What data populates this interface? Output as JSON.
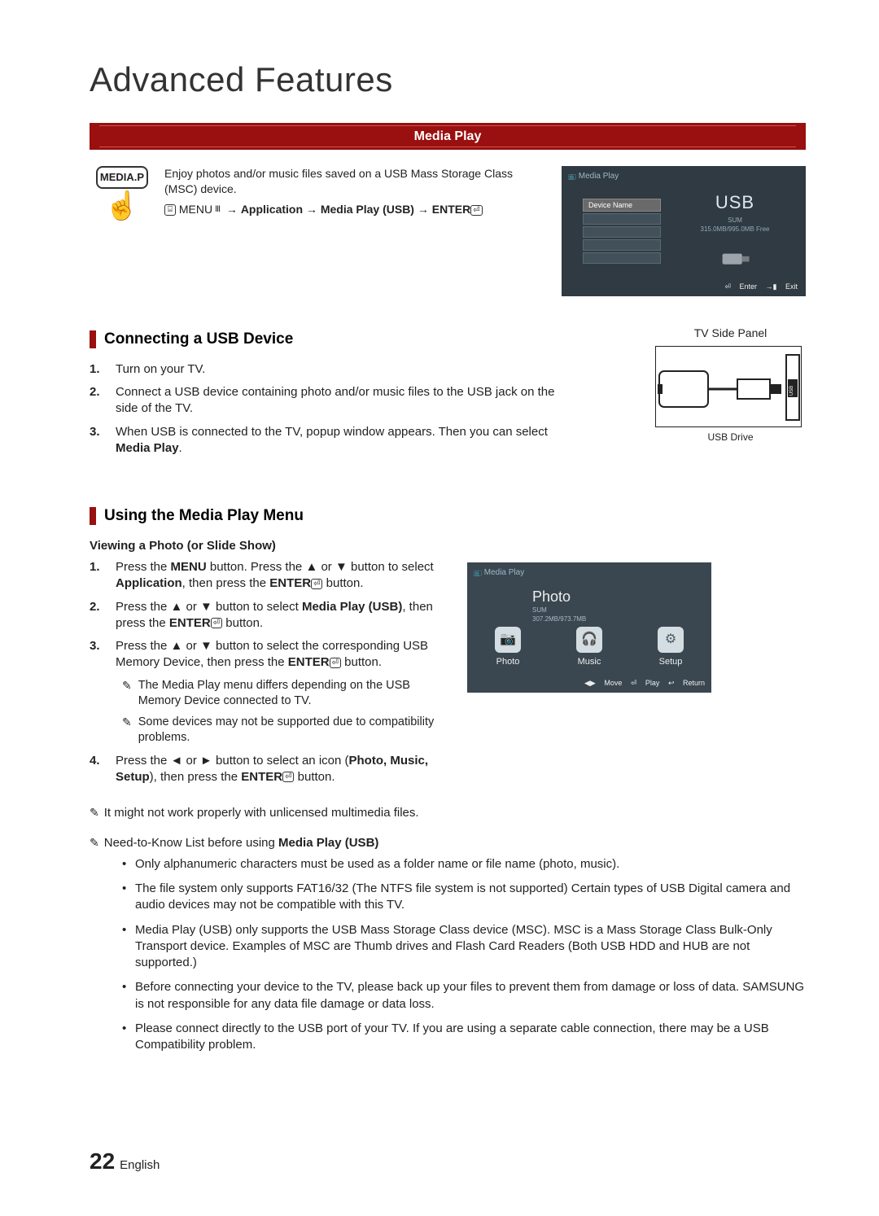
{
  "page": {
    "title": "Advanced Features",
    "section_bar": "Media Play",
    "number": "22",
    "language": "English"
  },
  "intro": {
    "remote_button": "MEDIA.P",
    "desc": "Enjoy photos and/or music files saved on a USB Mass Storage Class (MSC) device.",
    "menu_prefix": "MENU",
    "menu_app": "Application",
    "menu_mp": "Media Play (USB)",
    "menu_enter": "ENTER"
  },
  "tv1": {
    "header": "Media Play",
    "device_name": "Device Name",
    "usb": "USB",
    "sum": "SUM",
    "free": "315.0MB/995.0MB Free",
    "enter": "Enter",
    "exit": "Exit"
  },
  "sec_usb": {
    "title": "Connecting a USB Device",
    "steps": [
      "Turn on your TV.",
      "Connect a USB device containing photo and/or music files to the USB jack on the side of the TV.",
      "When USB is connected to the TV, popup window appears. Then you can select Media Play."
    ],
    "side_panel_label": "TV Side Panel",
    "usb_drive": "USB Drive"
  },
  "sec_menu": {
    "title": "Using the Media Play Menu",
    "sub_heading": "Viewing a Photo (or Slide Show)",
    "steps": [
      {
        "pre": "Press the ",
        "b1": "MENU",
        "mid1": " button. Press the ▲ or ▼ button to select ",
        "b2": "Application",
        "mid2": ", then press the ",
        "b3": "ENTER",
        "tail": " button."
      },
      {
        "pre": "Press the ▲ or ▼ button to select ",
        "b1": "Media Play (USB)",
        "mid1": ", then press the ",
        "b2": "ENTER",
        "tail": " button."
      },
      {
        "pre": "Press the ▲ or ▼ button to select the corresponding USB Memory Device, then press the ",
        "b1": "ENTER",
        "tail": " button."
      },
      {
        "pre": "Press the ◄ or ► button to select an icon (",
        "b1": "Photo, Music, Setup",
        "mid1": "), then press the ",
        "b2": "ENTER",
        "tail": " button."
      }
    ],
    "nested_notes": [
      "The Media Play menu differs depending on the USB Memory Device connected to TV.",
      "Some devices may not be supported due to compatibility problems."
    ],
    "end_note1": "It might not work properly with unlicensed multimedia files.",
    "end_note2_pre": "Need-to-Know List before using ",
    "end_note2_bold": "Media Play (USB)",
    "bullets": [
      "Only alphanumeric characters must be used as a folder name or file name (photo, music).",
      "The file system only supports FAT16/32 (The NTFS file system is not supported) Certain types of USB Digital camera and audio devices may not be compatible with this TV.",
      "Media Play (USB) only supports the USB Mass Storage Class device (MSC). MSC is a Mass Storage Class Bulk-Only Transport device. Examples of MSC are Thumb drives and Flash Card Readers (Both USB HDD and HUB are not supported.)",
      "Before connecting your device to the TV, please back up your files to prevent them from damage or loss of data. SAMSUNG is not responsible for any data file damage or data loss.",
      "Please connect directly to the USB port of your TV. If you are using a separate cable connection, there may be a USB Compatibility problem."
    ]
  },
  "tv2": {
    "header": "Media Play",
    "title": "Photo",
    "sum": "SUM",
    "free": "307.2MB/973.7MB",
    "icons": {
      "photo": "Photo",
      "music": "Music",
      "setup": "Setup"
    },
    "footer": {
      "move": "Move",
      "play": "Play",
      "return": "Return"
    }
  }
}
